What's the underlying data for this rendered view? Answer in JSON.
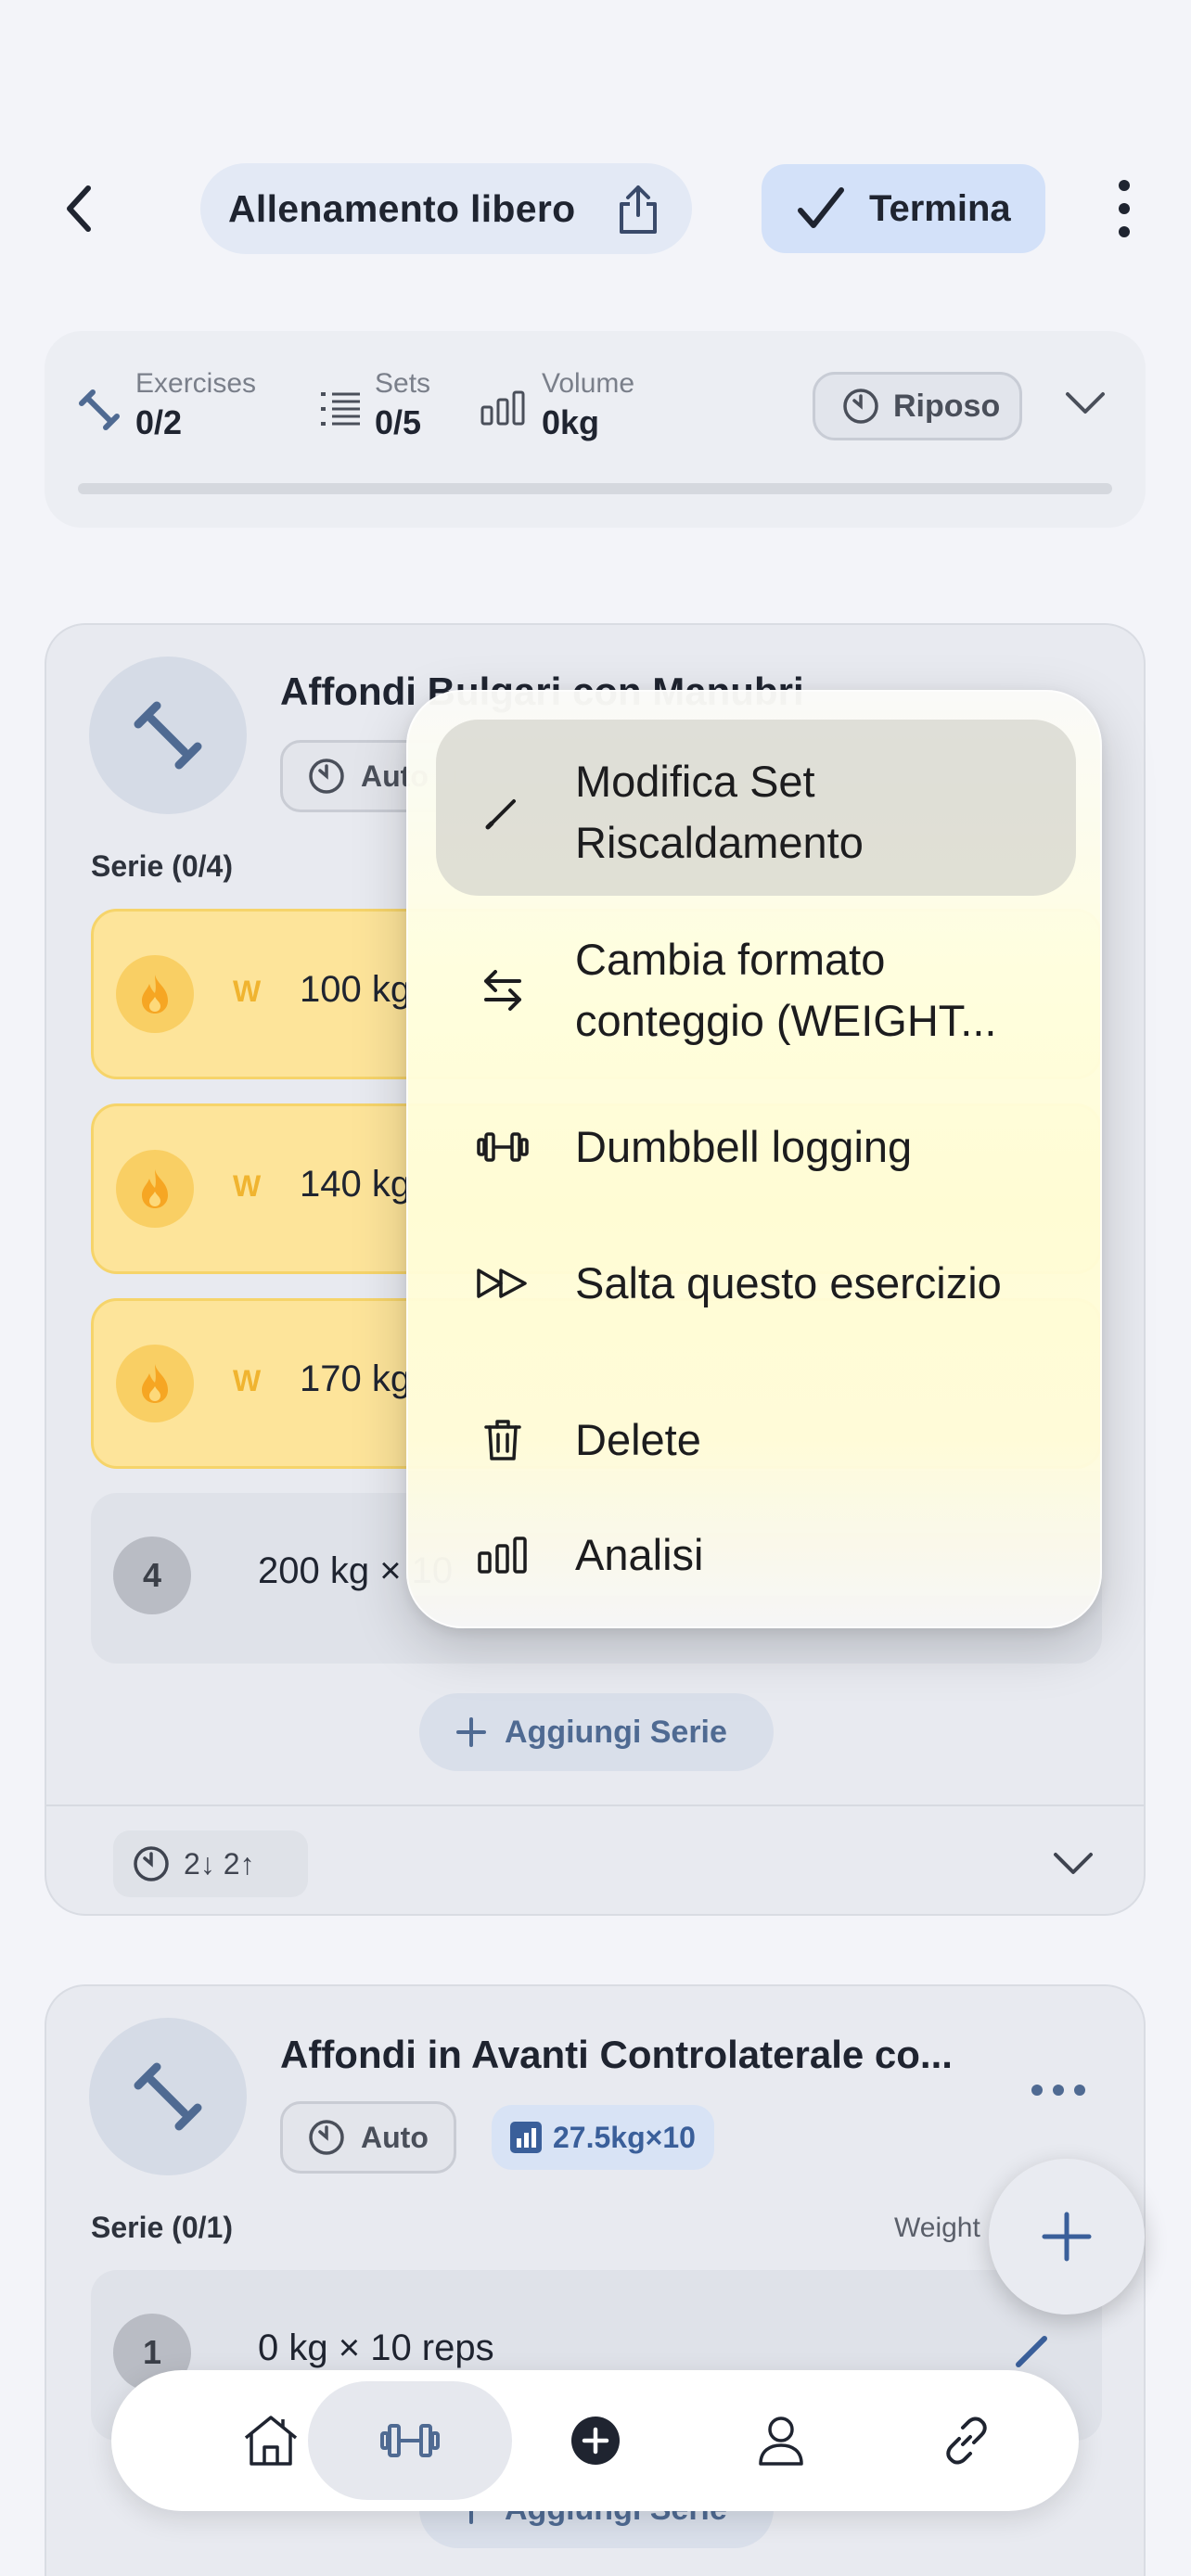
{
  "header": {
    "title": "Allenamento libero",
    "finish_label": "Termina"
  },
  "stats": {
    "exercises_label": "Exercises",
    "exercises_value": "0/2",
    "sets_label": "Sets",
    "sets_value": "0/5",
    "volume_label": "Volume",
    "volume_value": "0kg",
    "rest_label": "Riposo",
    "progress": 0
  },
  "exercise1": {
    "title": "Affondi Bulgari con Manubri",
    "auto_label": "Auto",
    "series_label": "Serie (0/4)",
    "sets": [
      {
        "marker": "W",
        "text": "100 kg"
      },
      {
        "marker": "W",
        "text": "140 kg"
      },
      {
        "marker": "W",
        "text": "170 kg"
      },
      {
        "number": "4",
        "text": "200 kg × 10"
      }
    ],
    "add_series_label": "Aggiungi Serie",
    "rest_chip": "2↓ 2↑"
  },
  "exercise2": {
    "title": "Affondi in Avanti Controlaterale co...",
    "auto_label": "Auto",
    "pr_label": "27.5kg×10",
    "series_label": "Serie (0/1)",
    "weight_label": "Weight",
    "sets": [
      {
        "number": "1",
        "text": "0 kg × 10 reps"
      }
    ],
    "add_series_label": "Aggiungi Serie"
  },
  "menu": {
    "items": [
      {
        "label": "Modifica Set Riscaldamento",
        "icon": "pencil-icon"
      },
      {
        "label": "Cambia formato conteggio (WEIGHT...",
        "icon": "swap-arrows-icon"
      },
      {
        "label": "Dumbbell logging",
        "icon": "dumbbell-icon"
      },
      {
        "label": "Salta questo esercizio",
        "icon": "skip-forward-icon"
      },
      {
        "label": "Delete",
        "icon": "trash-icon"
      },
      {
        "label": "Analisi",
        "icon": "bar-chart-icon"
      }
    ]
  },
  "nav": {
    "items": [
      "home-icon",
      "dumbbell-icon",
      "add-circle-icon",
      "profile-icon",
      "link-icon"
    ],
    "active": "dumbbell-icon"
  },
  "colors": {
    "accent": "#3a5f9a",
    "warmup": "#fde49a",
    "finish_bg": "#d3e1f9"
  }
}
